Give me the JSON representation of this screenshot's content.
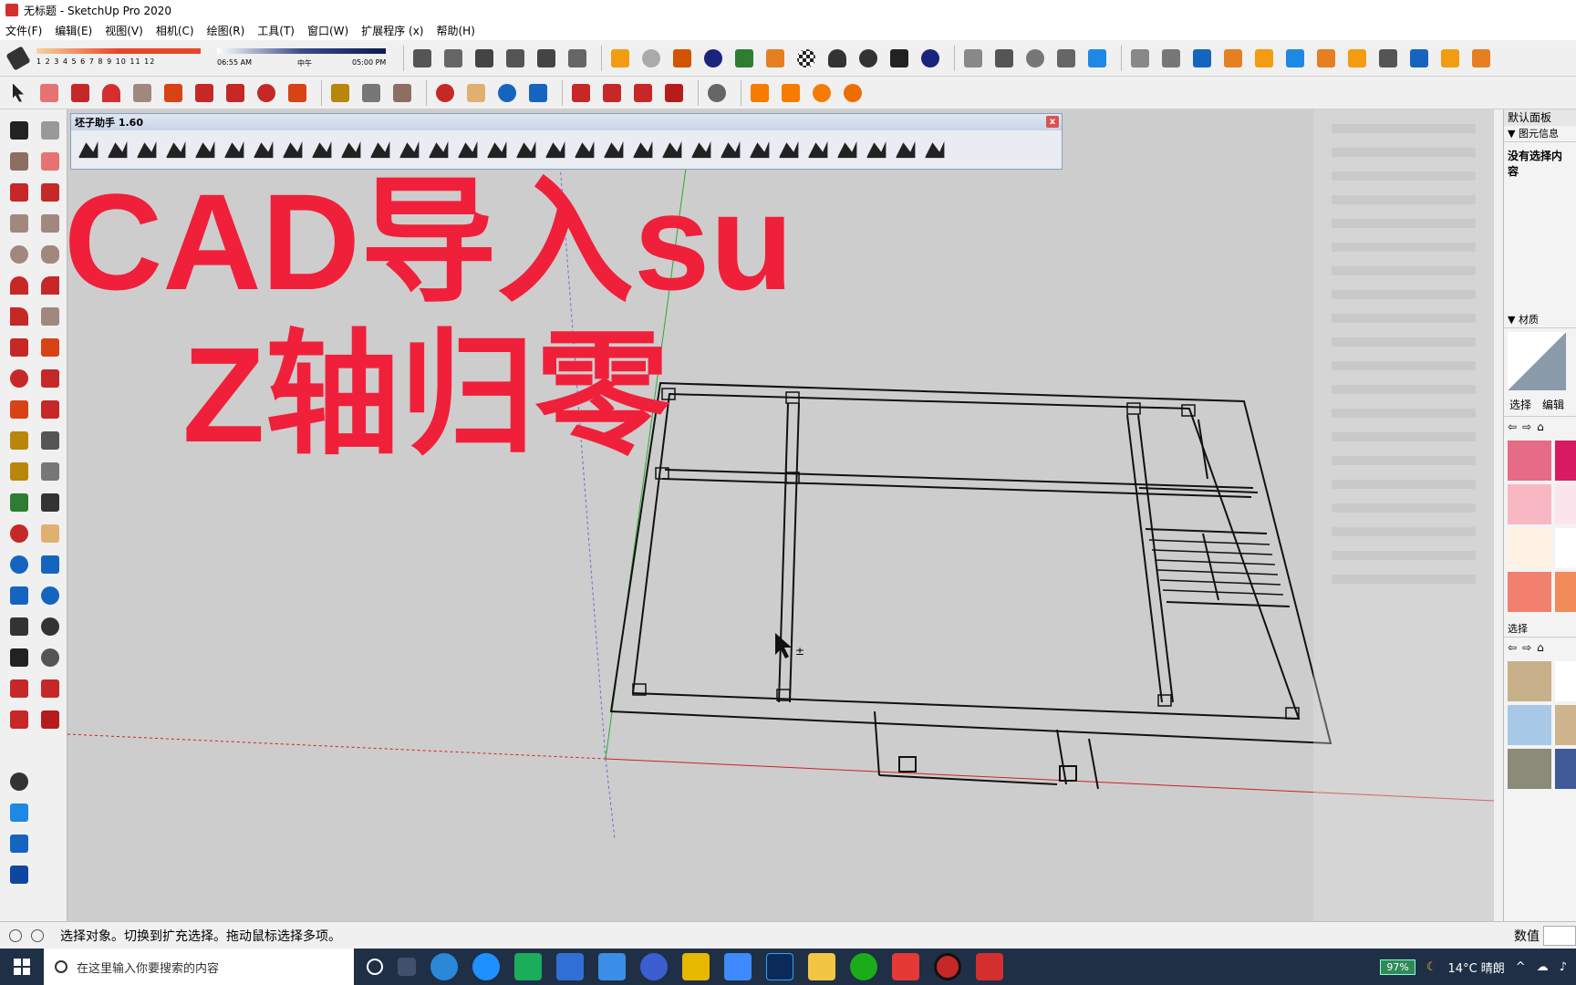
{
  "window": {
    "title": "无标题 - SketchUp Pro 2020"
  },
  "menu": [
    "文件(F)",
    "编辑(E)",
    "视图(V)",
    "相机(C)",
    "绘图(R)",
    "工具(T)",
    "窗口(W)",
    "扩展程序 (x)",
    "帮助(H)"
  ],
  "shadow": {
    "ticks": "1 2 3 4 5 6 7 8 9 10 11 12",
    "time_start": "06:55 AM",
    "time_mid": "中午",
    "time_end": "05:00 PM"
  },
  "plugin": {
    "title": "坯子助手 1.60",
    "close": "x"
  },
  "overlay": {
    "line1": "CAD导入su",
    "line2": "Z轴归零"
  },
  "right_panel": {
    "header": "默认面板",
    "entity_info": "▼ 图元信息",
    "no_selection": "没有选择内容",
    "materials": "▼ 材质",
    "tab_select": "选择",
    "tab_edit": "编辑",
    "select2": "选择"
  },
  "status": {
    "message": "选择对象。切换到扩充选择。拖动鼠标选择多项。",
    "vcb_label": "数值"
  },
  "taskbar": {
    "search_placeholder": "在这里输入你要搜索的内容",
    "battery": "97%",
    "weather": "14°C 晴朗"
  },
  "colors": {
    "overlay_red": "#f0203a",
    "viewport_bg": "#cdcdcd",
    "taskbar_bg": "#1f2f45"
  }
}
